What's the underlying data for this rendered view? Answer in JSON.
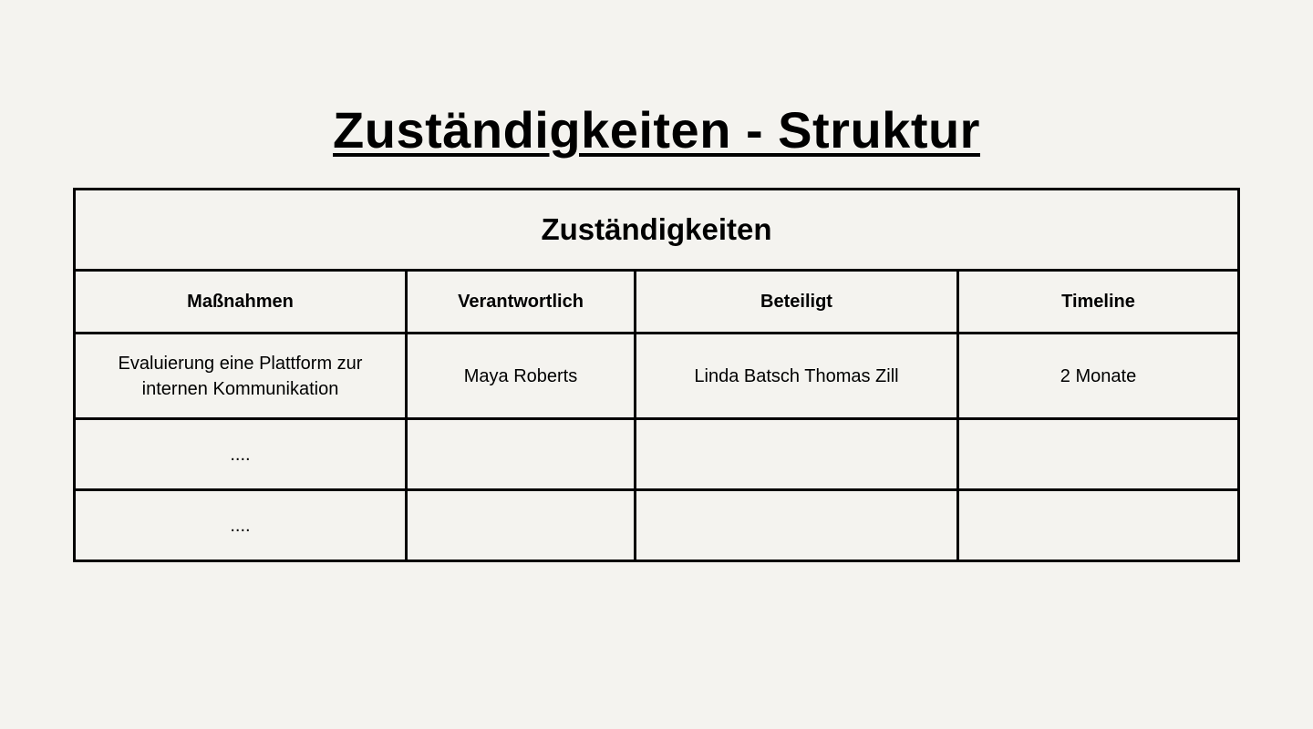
{
  "title": "Zuständigkeiten - Struktur",
  "table": {
    "caption": "Zuständigkeiten",
    "headers": [
      "Maßnahmen",
      "Verantwortlich",
      "Beteiligt",
      "Timeline"
    ],
    "rows": [
      [
        "Evaluierung eine Plattform zur internen Kommunikation",
        "Maya Roberts",
        "Linda Batsch Thomas Zill",
        "2 Monate"
      ],
      [
        "....",
        "",
        "",
        ""
      ],
      [
        "....",
        "",
        "",
        ""
      ]
    ]
  }
}
